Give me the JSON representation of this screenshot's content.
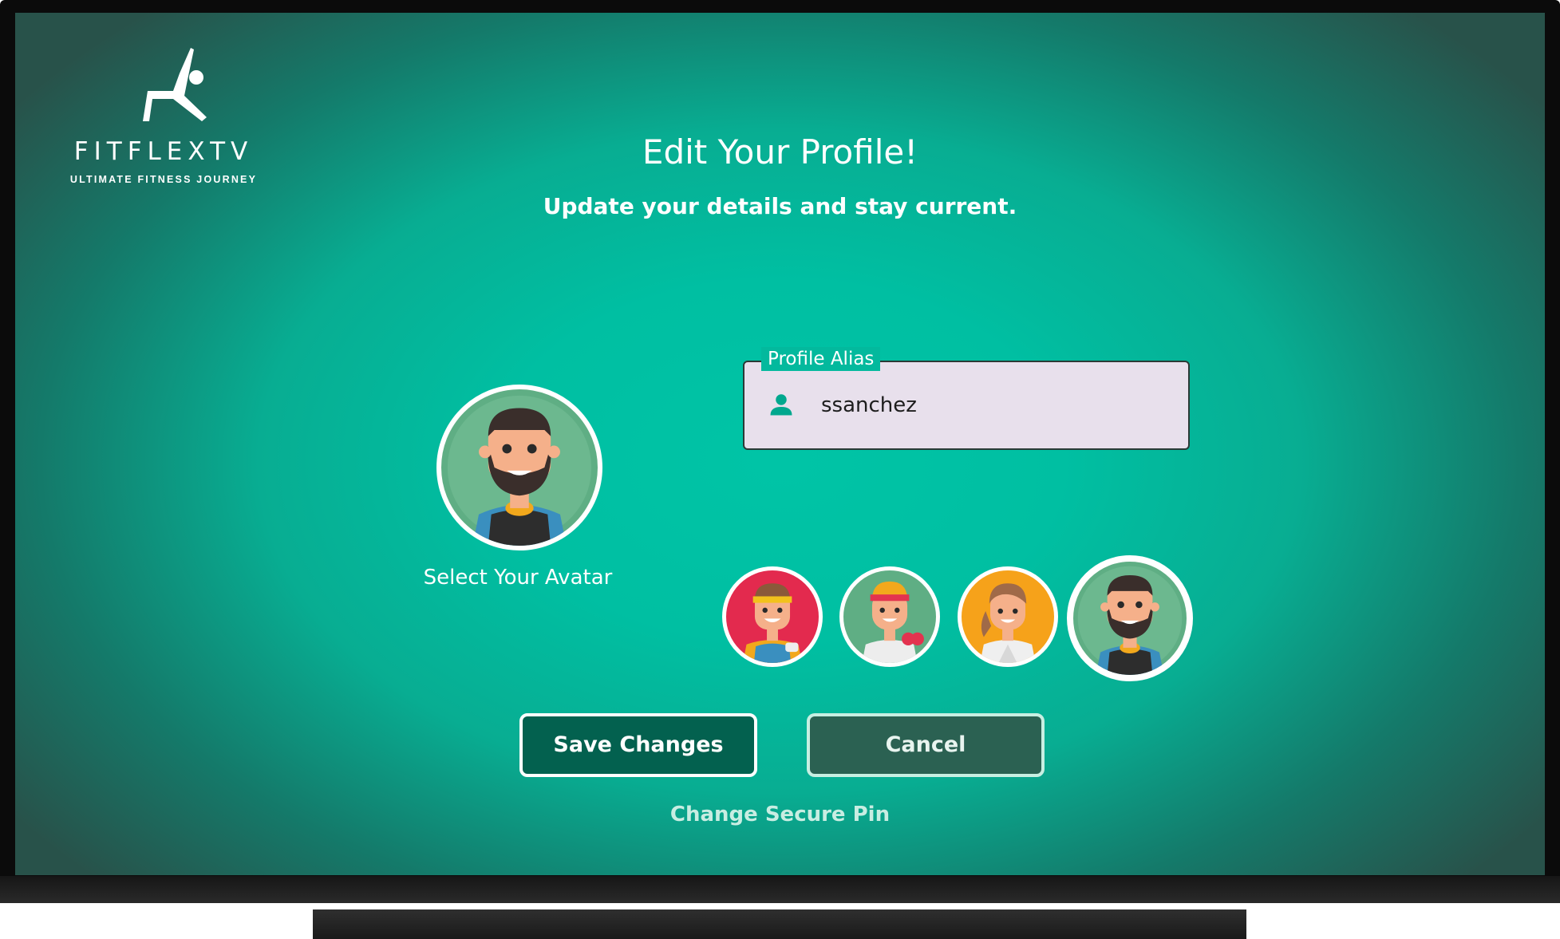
{
  "logo": {
    "wordmark": "FITFLEXTV",
    "tagline": "ULTIMATE FITNESS JOURNEY"
  },
  "header": {
    "title": "Edit Your Profile!",
    "subtitle": "Update your details and stay current."
  },
  "avatar": {
    "caption": "Select Your Avatar",
    "options": [
      {
        "icon": "avatar-man-headband-red-bg",
        "background": "#e32a4e",
        "selected": false
      },
      {
        "icon": "avatar-woman-headband-green-bg",
        "background": "#5fae84",
        "selected": false
      },
      {
        "icon": "avatar-woman-ponytail-orange-bg",
        "background": "#f6a21a",
        "selected": false
      },
      {
        "icon": "avatar-bearded-man-green-bg",
        "background": "#5fae84",
        "selected": true
      }
    ]
  },
  "alias": {
    "label": "Profile Alias",
    "value": "ssanchez",
    "icon": "person-icon"
  },
  "actions": {
    "save_label": "Save Changes",
    "cancel_label": "Cancel",
    "pin_label": "Change Secure Pin"
  },
  "colors": {
    "accent": "#00bfa2",
    "save_button": "#03614f",
    "cancel_button": "#2b6152",
    "field_bg": "#e8e0ec"
  }
}
